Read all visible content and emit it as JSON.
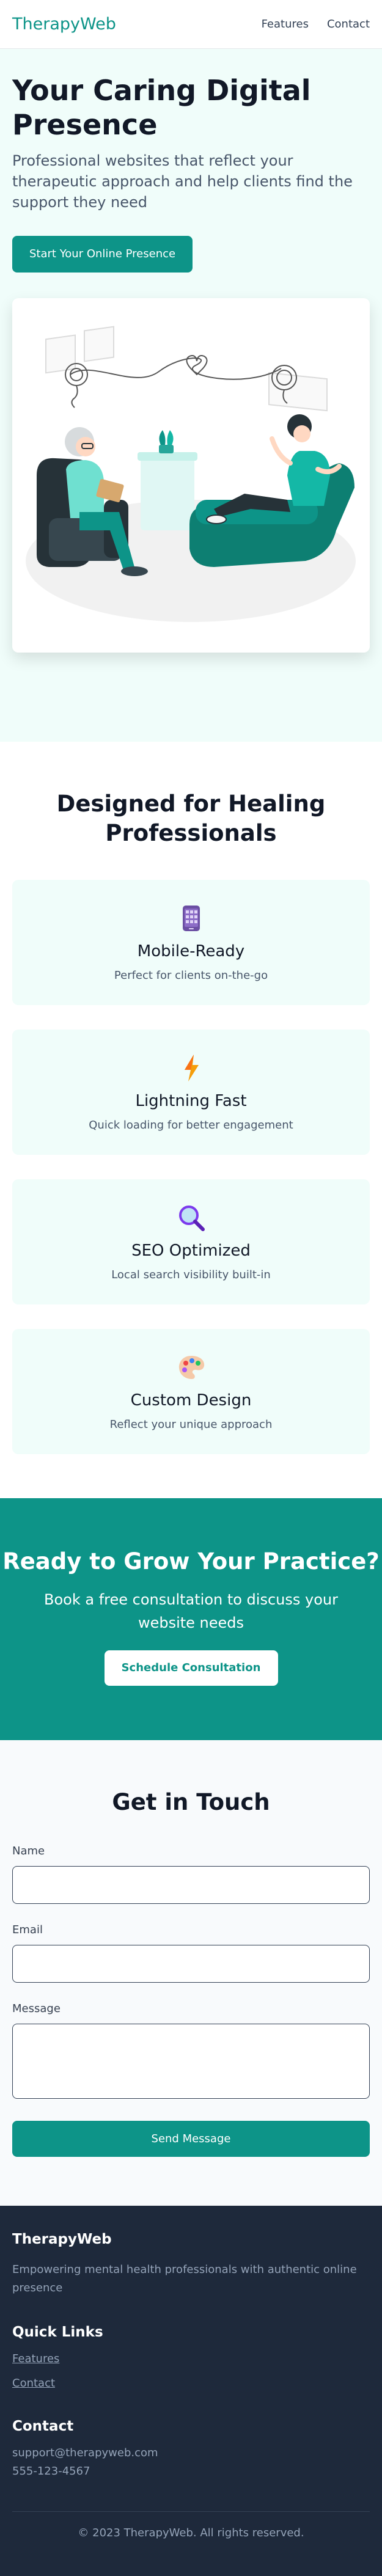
{
  "header": {
    "logo": "TherapyWeb",
    "nav": [
      "Features",
      "Contact"
    ]
  },
  "hero": {
    "title": "Your Caring Digital Presence",
    "subtitle": "Professional websites that reflect your therapeutic approach and help clients find the support they need",
    "cta_label": "Start Your Online Presence",
    "illustration_icon": "therapy-session-illustration"
  },
  "features": {
    "title": "Designed for Healing Professionals",
    "cards": [
      {
        "icon": "mobile-phone-icon",
        "title": "Mobile-Ready",
        "text": "Perfect for clients on-the-go"
      },
      {
        "icon": "lightning-icon",
        "title": "Lightning Fast",
        "text": "Quick loading for better engagement"
      },
      {
        "icon": "magnifier-icon",
        "title": "SEO Optimized",
        "text": "Local search visibility built-in"
      },
      {
        "icon": "palette-icon",
        "title": "Custom Design",
        "text": "Reflect your unique approach"
      }
    ]
  },
  "cta": {
    "title": "Ready to Grow Your Practice?",
    "text": "Book a free consultation to discuss your website needs",
    "button": "Schedule Consultation"
  },
  "contact": {
    "title": "Get in Touch",
    "name_label": "Name",
    "email_label": "Email",
    "message_label": "Message",
    "send_label": "Send Message"
  },
  "footer": {
    "brand": "TherapyWeb",
    "description": "Empowering mental health professionals with authentic online presence",
    "links_title": "Quick Links",
    "links": [
      "Features",
      "Contact"
    ],
    "contact_title": "Contact",
    "email": "support@therapyweb.com",
    "phone": "555-123-4567",
    "copyright": "© 2023 TherapyWeb. All rights reserved."
  },
  "colors": {
    "brand": "#0d9488",
    "hero_bg": "#f0fdfa",
    "footer_bg": "#1e293b"
  }
}
